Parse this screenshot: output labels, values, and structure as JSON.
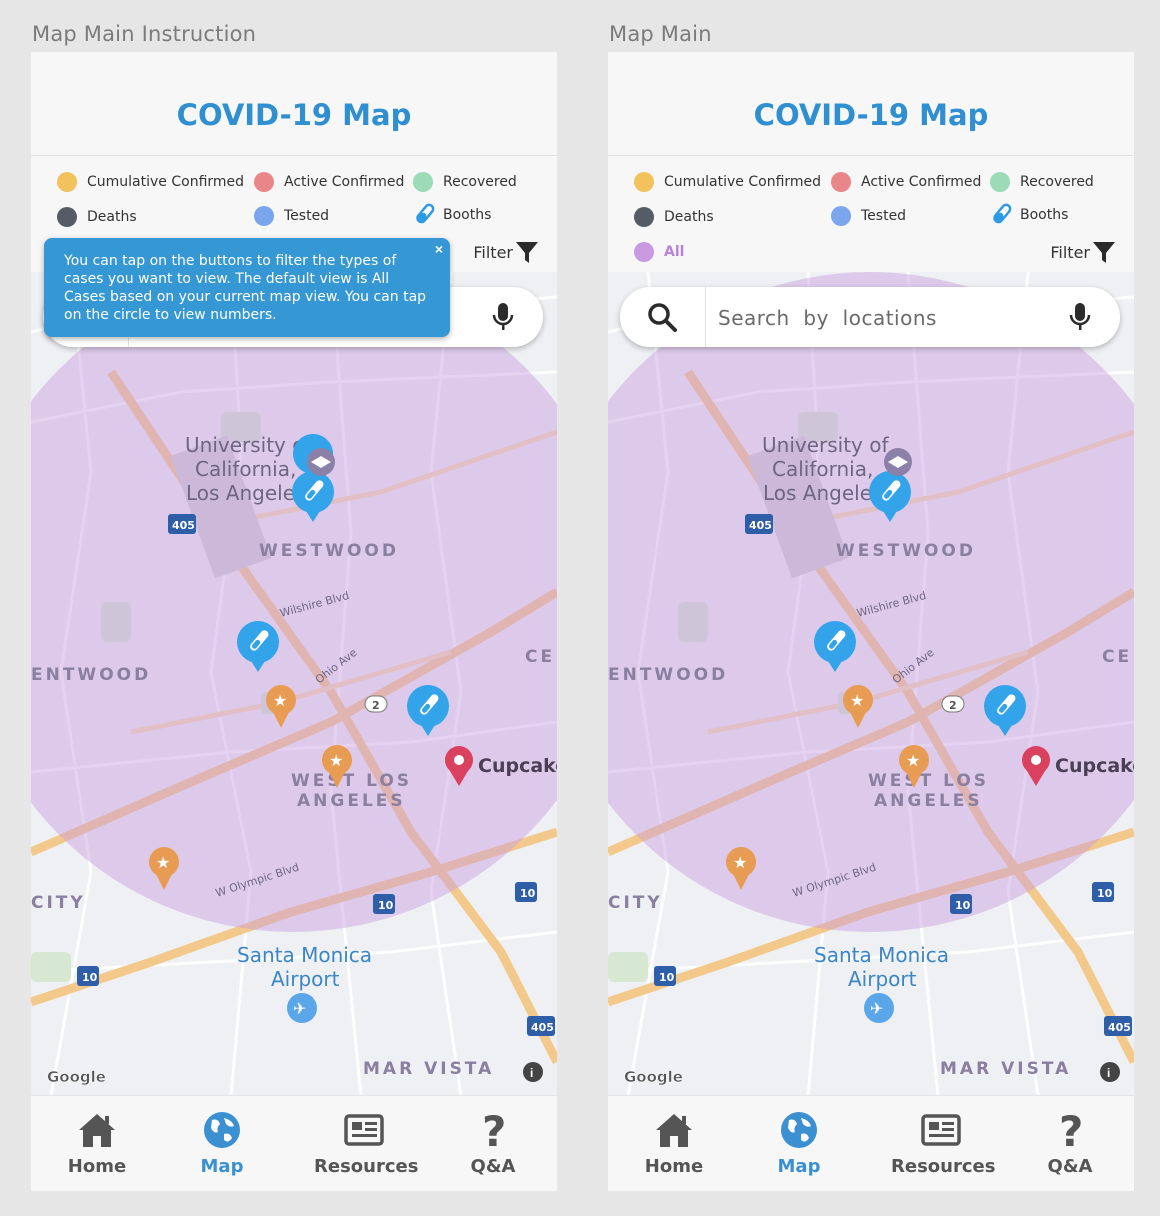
{
  "screens": [
    {
      "frame_label": "Map Main Instruction",
      "title": "COVID-19 Map",
      "legend": [
        {
          "label": "Cumulative Confirmed",
          "color": "#f2c35d"
        },
        {
          "label": "Active Confirmed",
          "color": "#e98689"
        },
        {
          "label": "Recovered",
          "color": "#9bdbb7"
        },
        {
          "label": "Deaths",
          "color": "#565c66"
        },
        {
          "label": "Tested",
          "color": "#7ba6ee"
        },
        {
          "label": "Booths",
          "icon": "test-tube-icon"
        }
      ],
      "filter_label": "Filter",
      "tooltip": "You can tap on the buttons to filter the types of cases you want to view. The default view is All Cases based on your current map view. You can tap on the circle to view numbers.",
      "tooltip_close": "×",
      "search_placeholder": "",
      "map_labels": {
        "ucla": "University of",
        "ucla2": "California,",
        "ucla3": "Los Angeles",
        "westwood": "WESTWOOD",
        "brentwood": "ENTWOOD",
        "wla1": "WEST LOS",
        "wla2": "ANGELES",
        "cupcake": "Cupcake",
        "smo1": "Santa Monica",
        "smo2": "Airport",
        "marvista": "MAR VISTA",
        "city": "CITY",
        "cen": "CE",
        "wilshire": "Wilshire Blvd",
        "ohio": "Ohio Ave",
        "olympic": "W Olympic Blvd",
        "google": "Google",
        "r405": "405",
        "r10": "10",
        "r2": "2"
      },
      "tabs": [
        {
          "label": "Home",
          "icon": "home-icon"
        },
        {
          "label": "Map",
          "icon": "globe-icon"
        },
        {
          "label": "Resources",
          "icon": "newspaper-icon"
        },
        {
          "label": "Q&A",
          "icon": "question-icon"
        }
      ]
    },
    {
      "frame_label": "Map Main",
      "title": "COVID-19 Map",
      "legend": [
        {
          "label": "Cumulative Confirmed",
          "color": "#f2c35d"
        },
        {
          "label": "Active Confirmed",
          "color": "#e98689"
        },
        {
          "label": "Recovered",
          "color": "#9bdbb7"
        },
        {
          "label": "Deaths",
          "color": "#565c66"
        },
        {
          "label": "Tested",
          "color": "#7ba6ee"
        },
        {
          "label": "Booths",
          "icon": "test-tube-icon"
        },
        {
          "label": "All",
          "color": "#c89be0"
        }
      ],
      "filter_label": "Filter",
      "search_placeholder": "Search  by  locations",
      "map_labels": {
        "ucla": "University of",
        "ucla2": "California,",
        "ucla3": "Los Angeles",
        "westwood": "WESTWOOD",
        "brentwood": "ENTWOOD",
        "wla1": "WEST LOS",
        "wla2": "ANGELES",
        "cupcake": "Cupcake",
        "smo1": "Santa Monica",
        "smo2": "Airport",
        "marvista": "MAR VISTA",
        "city": "CITY",
        "cen": "CE",
        "wilshire": "Wilshire Blvd",
        "ohio": "Ohio Ave",
        "olympic": "W Olympic Blvd",
        "google": "Google",
        "r405": "405",
        "r10": "10",
        "r2": "2"
      },
      "tabs": [
        {
          "label": "Home",
          "icon": "home-icon"
        },
        {
          "label": "Map",
          "icon": "globe-icon"
        },
        {
          "label": "Resources",
          "icon": "newspaper-icon"
        },
        {
          "label": "Q&A",
          "icon": "question-icon"
        }
      ]
    }
  ],
  "colors": {
    "accent": "#2f8fd0",
    "tooltip": "#3597d3",
    "overlay": "#c89be0",
    "booth_marker": "#34a4ea"
  }
}
